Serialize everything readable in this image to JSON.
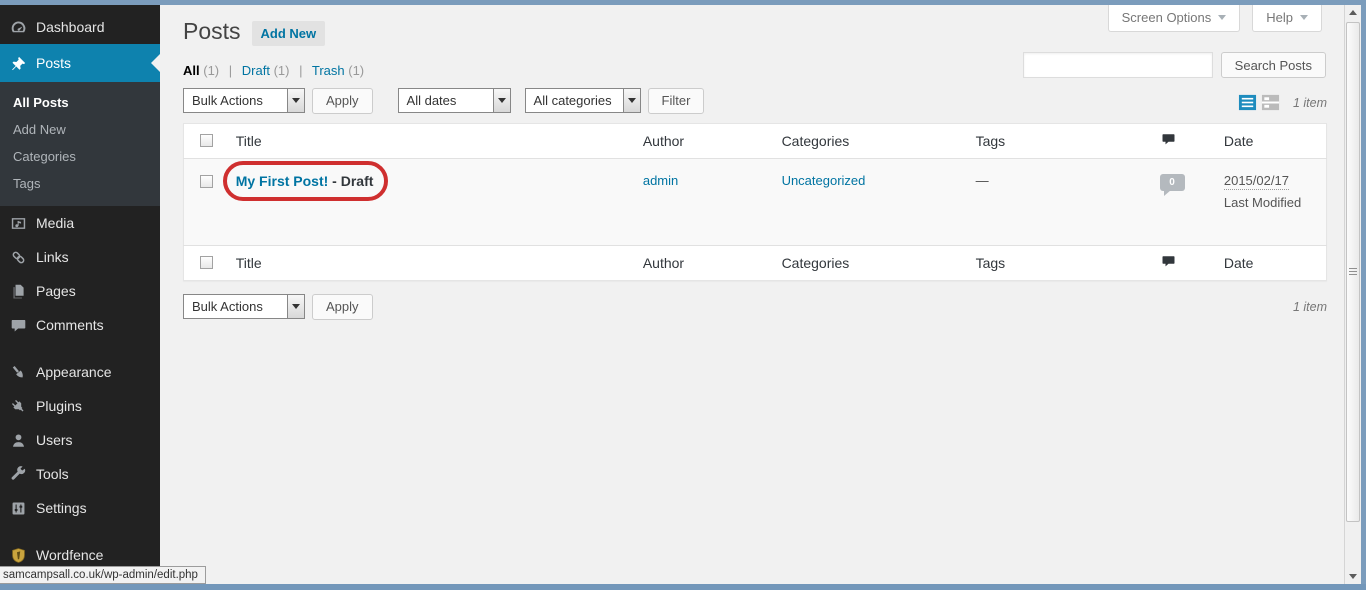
{
  "colors": {
    "accent_blue": "#0074a2",
    "active_menu_blue": "#0e82ae",
    "sidebar_bg": "#222222",
    "submenu_bg": "#32373c",
    "annotation_red": "#cf2f2f",
    "window_frame_blue": "#7b9cbc"
  },
  "window": {
    "status_link_preview": "samcampsall.co.uk/wp-admin/edit.php"
  },
  "meta_tabs": {
    "screen_options": "Screen Options",
    "help": "Help"
  },
  "page": {
    "title": "Posts",
    "add_new_label": "Add New"
  },
  "views": {
    "all_label": "All",
    "all_count": "(1)",
    "draft_label": "Draft",
    "draft_count": "(1)",
    "trash_label": "Trash",
    "trash_count": "(1)",
    "separator": "|"
  },
  "toolbar": {
    "bulk_actions_label": "Bulk Actions",
    "apply_label": "Apply",
    "all_dates_label": "All dates",
    "all_categories_label": "All categories",
    "filter_label": "Filter"
  },
  "search": {
    "value": "",
    "button_label": "Search Posts"
  },
  "pagination": {
    "item_count": "1 item"
  },
  "sidebar": {
    "items": [
      {
        "label": "Dashboard",
        "icon": "dashboard-icon"
      },
      {
        "label": "Posts",
        "icon": "pushpin-icon",
        "active": true
      },
      {
        "label": "Media",
        "icon": "media-icon"
      },
      {
        "label": "Links",
        "icon": "links-icon"
      },
      {
        "label": "Pages",
        "icon": "pages-icon"
      },
      {
        "label": "Comments",
        "icon": "comments-icon"
      },
      {
        "label": "Appearance",
        "icon": "appearance-icon"
      },
      {
        "label": "Plugins",
        "icon": "plugins-icon"
      },
      {
        "label": "Users",
        "icon": "users-icon"
      },
      {
        "label": "Tools",
        "icon": "tools-icon"
      },
      {
        "label": "Settings",
        "icon": "settings-icon"
      },
      {
        "label": "Wordfence",
        "icon": "wordfence-shield-icon"
      }
    ],
    "posts_submenu": [
      "All Posts",
      "Add New",
      "Categories",
      "Tags"
    ]
  },
  "table": {
    "columns": {
      "title": "Title",
      "author": "Author",
      "categories": "Categories",
      "tags": "Tags",
      "comments_icon": "comment-bubble-icon",
      "date": "Date"
    },
    "row": {
      "title": "My First Post!",
      "status_suffix": " - Draft",
      "author": "admin",
      "category": "Uncategorized",
      "tags": "—",
      "comment_count": "0",
      "date": "2015/02/17",
      "date_note": "Last Modified"
    }
  }
}
